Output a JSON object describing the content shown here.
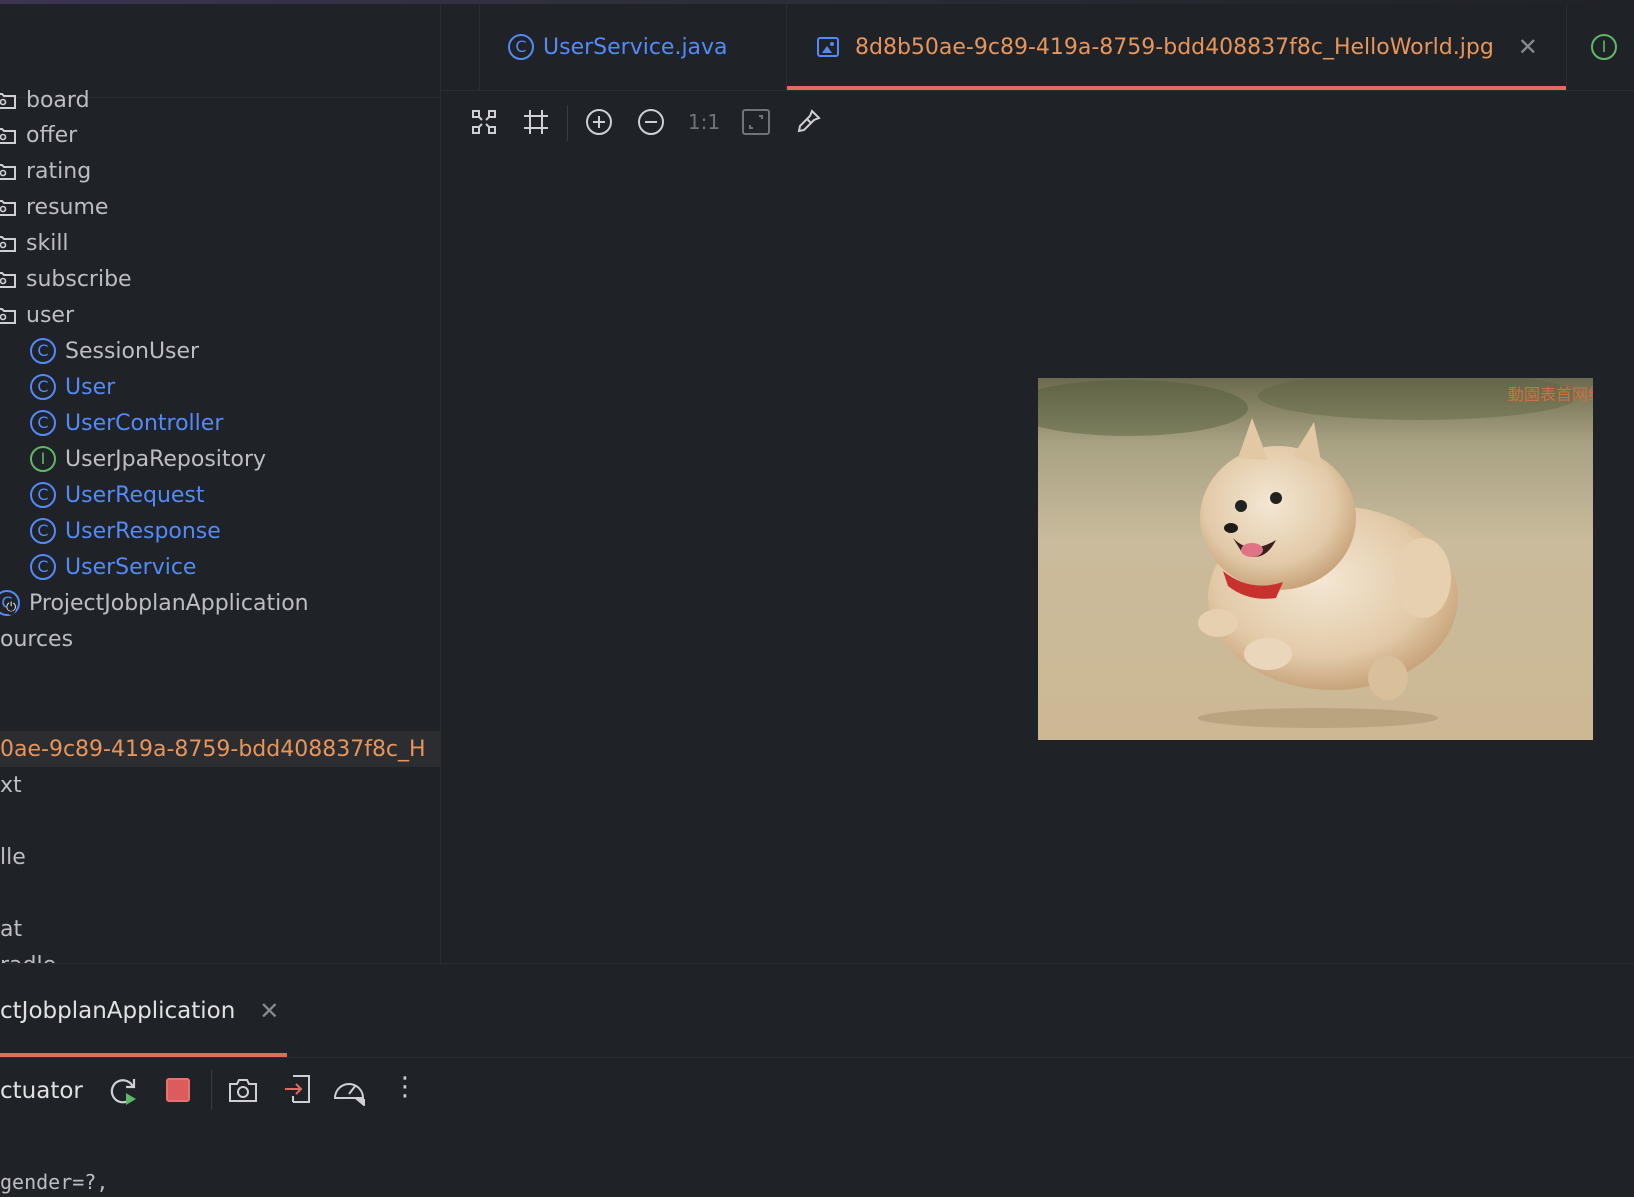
{
  "tabs": [
    {
      "label": "UserService.java",
      "icon": "class-icon"
    },
    {
      "label": "8d8b50ae-9c89-419a-8759-bdd408837f8c_HelloWorld.jpg",
      "icon": "image-file-icon",
      "active": true
    },
    {
      "label": "",
      "icon": "interface-icon"
    }
  ],
  "tree": {
    "folders": [
      "board",
      "offer",
      "rating",
      "resume",
      "skill",
      "subscribe",
      "user"
    ],
    "user_children": [
      {
        "label": "SessionUser",
        "kind": "class",
        "color": "normal"
      },
      {
        "label": "User",
        "kind": "class",
        "color": "blue"
      },
      {
        "label": "UserController",
        "kind": "class",
        "color": "blue"
      },
      {
        "label": "UserJpaRepository",
        "kind": "interface",
        "color": "normal"
      },
      {
        "label": "UserRequest",
        "kind": "class",
        "color": "blue"
      },
      {
        "label": "UserResponse",
        "kind": "class",
        "color": "blue"
      },
      {
        "label": "UserService",
        "kind": "class",
        "color": "blue"
      }
    ],
    "app_class": "ProjectJobplanApplication",
    "resources": "ources",
    "selected_file": "0ae-9c89-419a-8759-bdd408837f8c_H",
    "more": [
      "xt",
      "lle",
      "at",
      "radle"
    ]
  },
  "image_toolbar": {
    "actual_size_label": "1:1"
  },
  "image_watermark": "動園表首网络",
  "run": {
    "tab_label": "ctJobplanApplication",
    "actuator_label": "ctuator",
    "console_line": "gender=?,"
  },
  "colors": {
    "accent_blue": "#548af7",
    "accent_orange": "#e8955b",
    "active_underline": "#e46a5f",
    "interface_green": "#5fb865"
  }
}
